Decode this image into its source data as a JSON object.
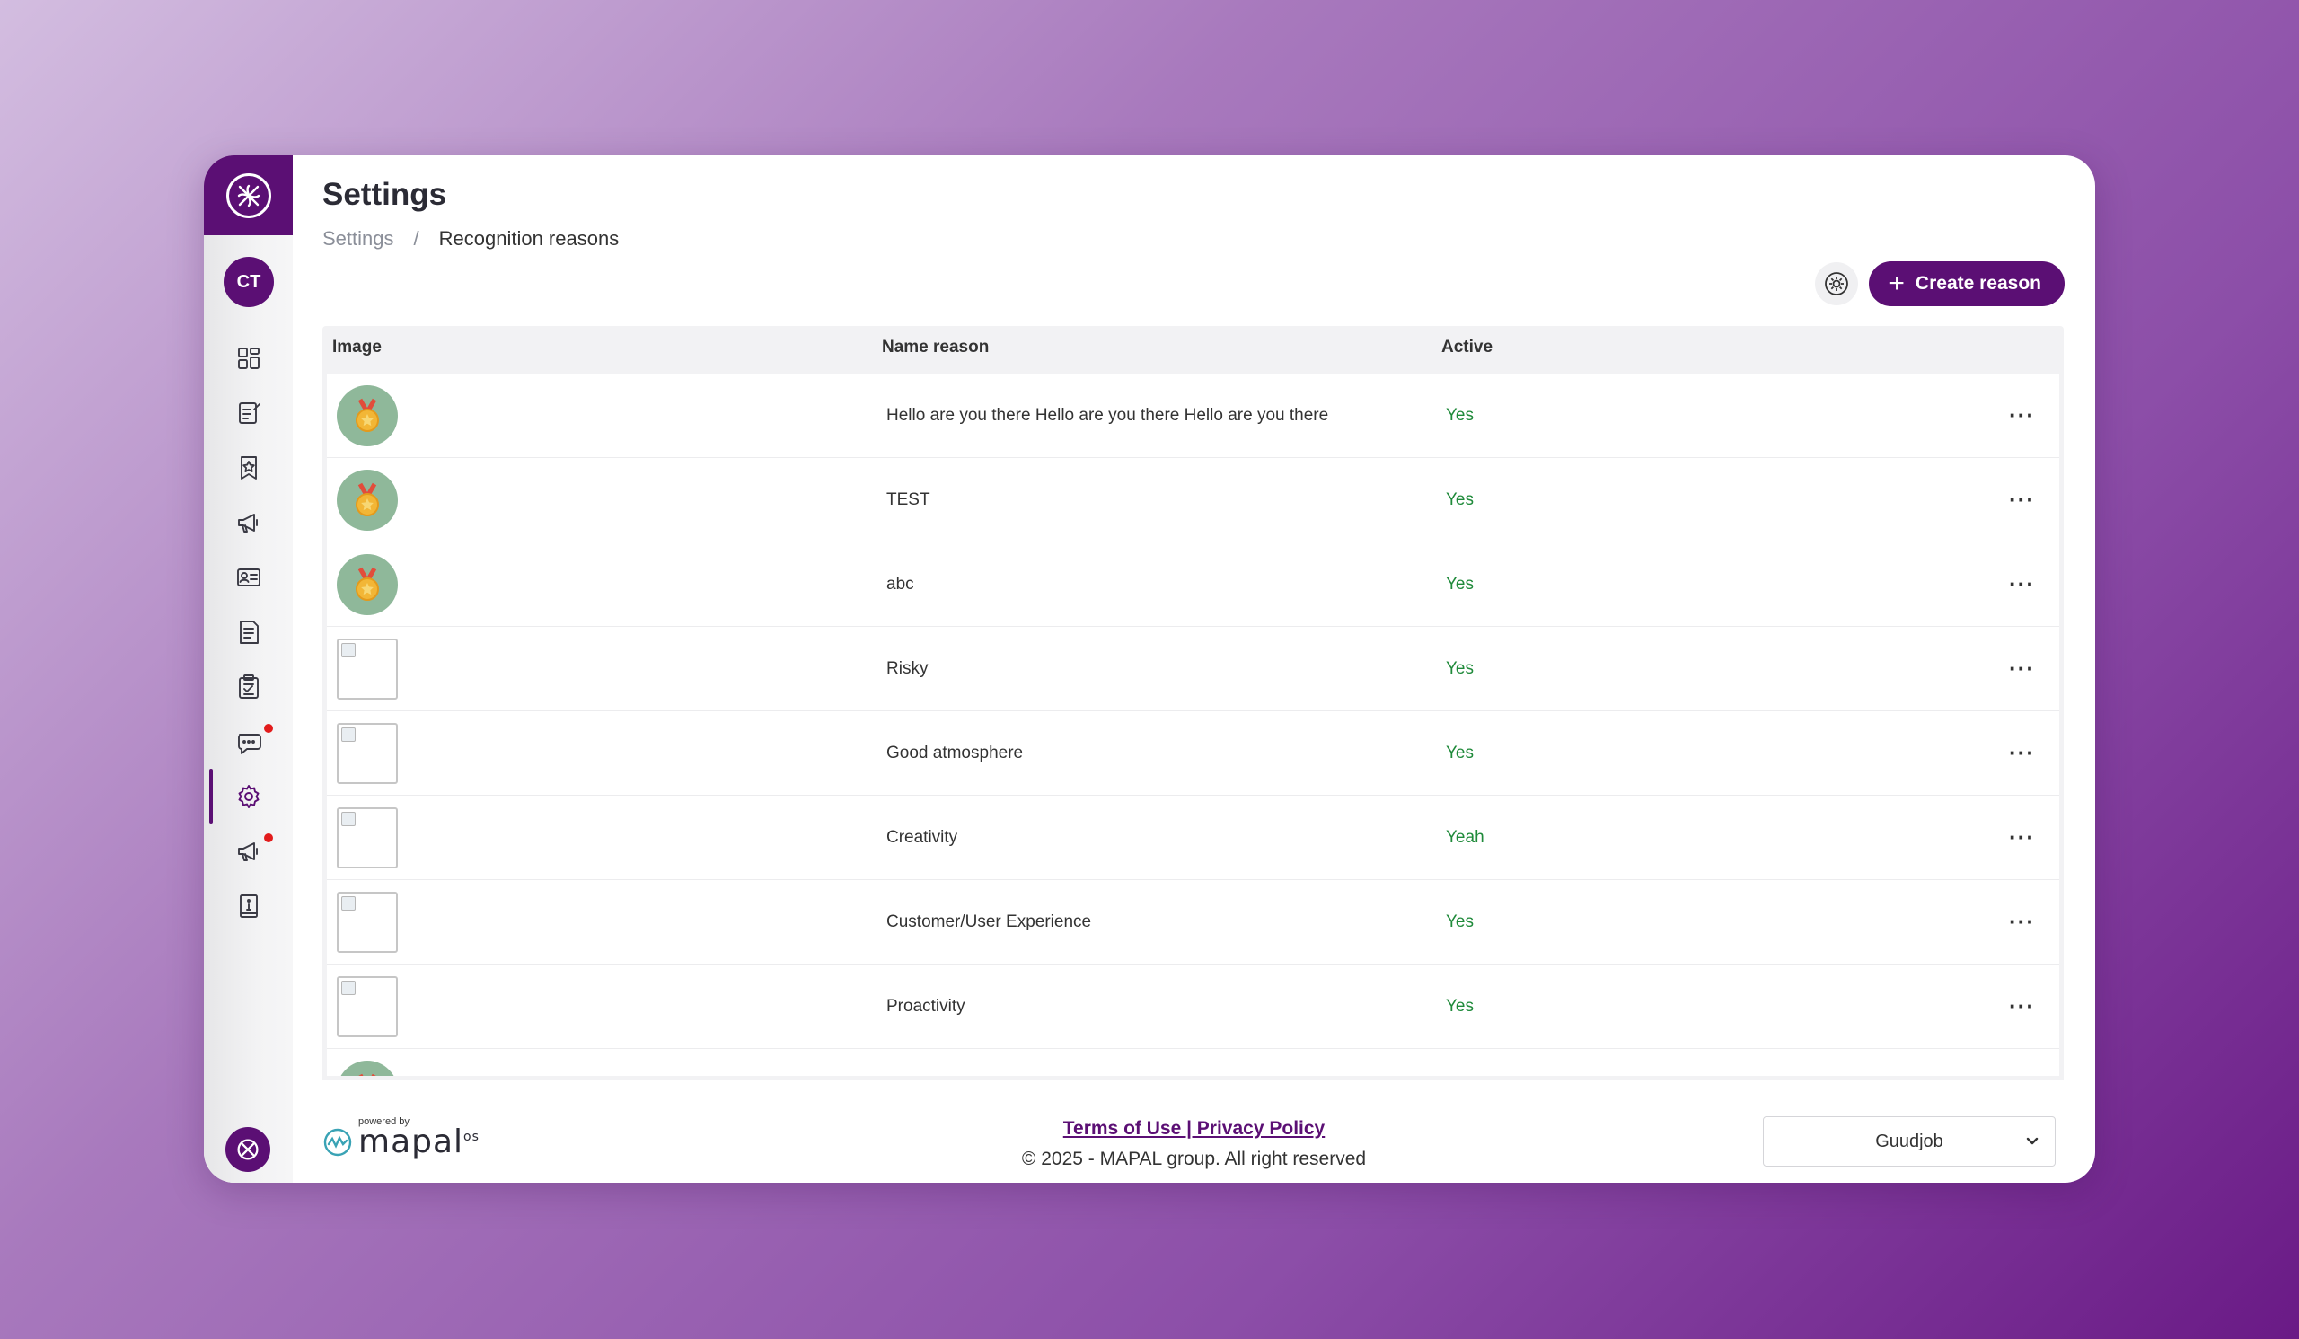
{
  "sidebar": {
    "avatar_initials": "CT",
    "nav": [
      {
        "icon": "dashboard-icon",
        "active": false,
        "badge": false
      },
      {
        "icon": "edit-note-icon",
        "active": false,
        "badge": false
      },
      {
        "icon": "bookmark-star-icon",
        "active": false,
        "badge": false
      },
      {
        "icon": "megaphone-icon",
        "active": false,
        "badge": false
      },
      {
        "icon": "id-card-icon",
        "active": false,
        "badge": false
      },
      {
        "icon": "document-icon",
        "active": false,
        "badge": false
      },
      {
        "icon": "clipboard-check-icon",
        "active": false,
        "badge": false
      },
      {
        "icon": "chat-icon",
        "active": false,
        "badge": true
      },
      {
        "icon": "gear-icon",
        "active": true,
        "badge": false
      },
      {
        "icon": "megaphone-icon",
        "active": false,
        "badge": true
      },
      {
        "icon": "info-book-icon",
        "active": false,
        "badge": false
      }
    ]
  },
  "header": {
    "title": "Settings",
    "breadcrumb_root": "Settings",
    "breadcrumb_sep": "/",
    "breadcrumb_current": "Recognition reasons"
  },
  "toolbar": {
    "create_label": "Create reason"
  },
  "table": {
    "columns": {
      "image": "Image",
      "name": "Name reason",
      "active": "Active"
    },
    "rows": [
      {
        "image": "medal",
        "name": "Hello are you there Hello are you there Hello are you there",
        "active": "Yes"
      },
      {
        "image": "medal",
        "name": "TEST",
        "active": "Yes"
      },
      {
        "image": "medal",
        "name": "abc",
        "active": "Yes"
      },
      {
        "image": "broken",
        "name": "Risky",
        "active": "Yes"
      },
      {
        "image": "broken",
        "name": "Good atmosphere",
        "active": "Yes"
      },
      {
        "image": "broken",
        "name": "Creativity",
        "active": "Yeah"
      },
      {
        "image": "broken",
        "name": "Customer/User Experience",
        "active": "Yes"
      },
      {
        "image": "broken",
        "name": "Proactivity",
        "active": "Yes"
      },
      {
        "image": "medal",
        "name": "",
        "active": ""
      }
    ]
  },
  "footer": {
    "powered_by": "powered by",
    "brand": "mapal",
    "brand_suffix": "os",
    "terms_link": "Terms of Use | Privacy Policy",
    "copyright": "© 2025 - MAPAL group. All right reserved",
    "company_select": "Guudjob"
  },
  "colors": {
    "brand": "#5b0f74",
    "active_text": "#1f8a3a",
    "badge": "#e21b1b",
    "medal_bg": "#8fb89a"
  }
}
